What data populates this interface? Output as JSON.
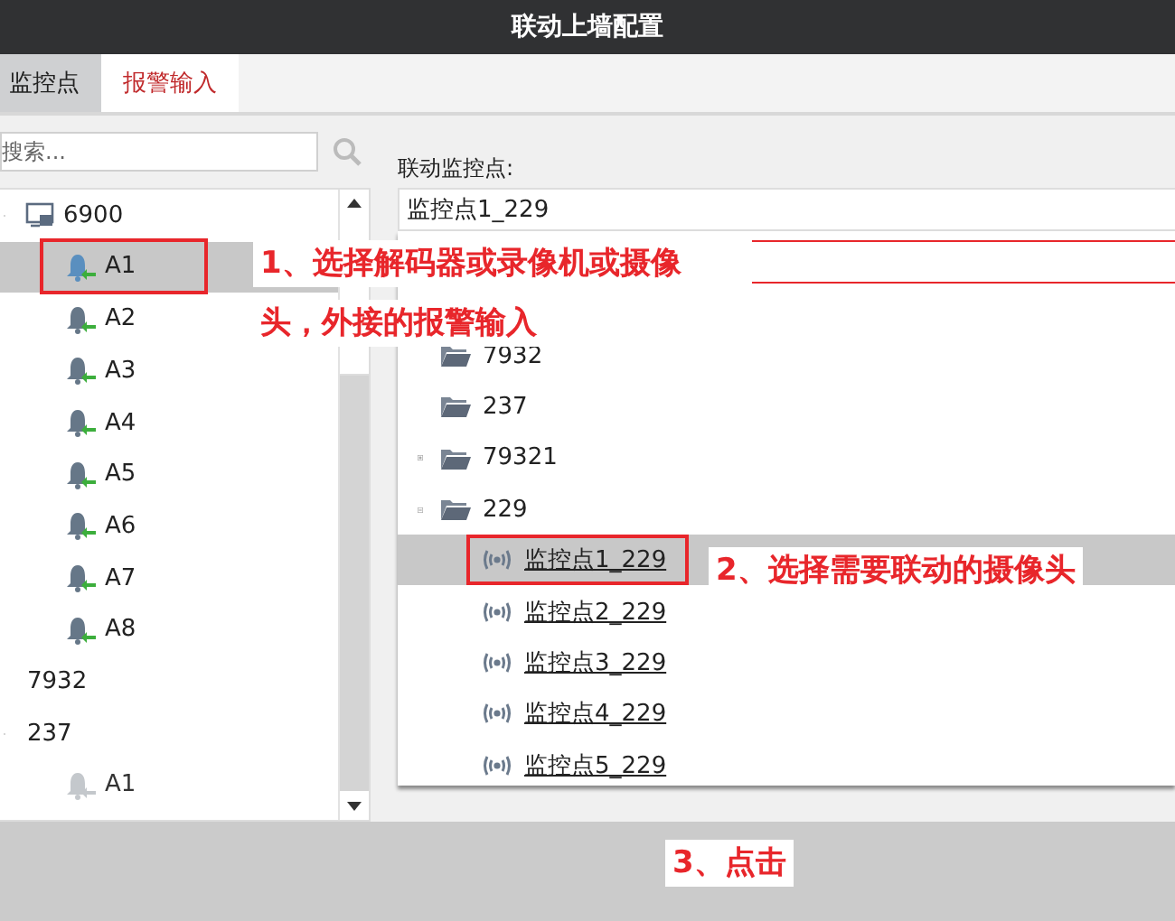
{
  "window": {
    "title": "联动上墙配置"
  },
  "tabs": [
    {
      "label": "监控点",
      "selected": false
    },
    {
      "label": "报警输入",
      "selected": true
    }
  ],
  "search": {
    "placeholder": "搜索..."
  },
  "alarm_tree": [
    {
      "label": "6900",
      "kind": "device",
      "expanded": true,
      "children": [
        {
          "label": "A1",
          "kind": "alarm",
          "selected": true,
          "highlighted": true,
          "disabled": false
        },
        {
          "label": "A2",
          "kind": "alarm",
          "selected": false,
          "disabled": false
        },
        {
          "label": "A3",
          "kind": "alarm",
          "selected": false,
          "disabled": false
        },
        {
          "label": "A4",
          "kind": "alarm",
          "selected": false,
          "disabled": false
        },
        {
          "label": "A5",
          "kind": "alarm",
          "selected": false,
          "disabled": false
        },
        {
          "label": "A6",
          "kind": "alarm",
          "selected": false,
          "disabled": false
        },
        {
          "label": "A7",
          "kind": "alarm",
          "selected": false,
          "disabled": false
        },
        {
          "label": "A8",
          "kind": "alarm",
          "selected": false,
          "disabled": false
        }
      ]
    },
    {
      "label": "7932",
      "kind": "plain"
    },
    {
      "label": "237",
      "kind": "plain",
      "expanded": true,
      "children": [
        {
          "label": "A1",
          "kind": "alarm",
          "selected": false,
          "disabled": true
        }
      ]
    }
  ],
  "linked": {
    "label": "联动监控点:",
    "value": "监控点1_229"
  },
  "camera_tree": [
    {
      "label": "7932",
      "kind": "folder"
    },
    {
      "label": "237",
      "kind": "folder"
    },
    {
      "label": "79321",
      "kind": "folder",
      "expanded": false
    },
    {
      "label": "229",
      "kind": "folder",
      "expanded": true,
      "children": [
        {
          "label": "监控点1_229",
          "kind": "camera",
          "selected": true,
          "highlighted": true
        },
        {
          "label": "监控点2_229",
          "kind": "camera",
          "selected": false
        },
        {
          "label": "监控点3_229",
          "kind": "camera",
          "selected": false
        },
        {
          "label": "监控点4_229",
          "kind": "camera",
          "selected": false
        },
        {
          "label": "监控点5_229",
          "kind": "camera",
          "selected": false
        }
      ]
    }
  ],
  "annotations": [
    {
      "lines": [
        "1、选择解码器或录像机或摄像",
        "头，外接的报警输入"
      ]
    },
    {
      "lines": [
        "2、选择需要联动的摄像头"
      ]
    },
    {
      "lines": [
        "3、点击"
      ]
    }
  ]
}
